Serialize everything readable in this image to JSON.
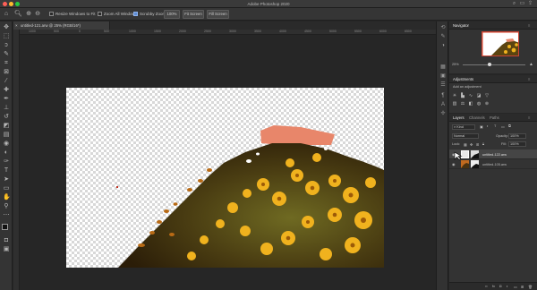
{
  "app": {
    "title": "Adobe Photoshop 2020"
  },
  "options_bar": {
    "resize_windows_label": "Resize Windows to Fit",
    "zoom_all_windows_label": "Zoom All Windows",
    "scrubby_zoom_label": "Scrubby Zoom",
    "btn_100": "100%",
    "btn_fit_screen": "Fit Screen",
    "btn_fill_screen": "Fill Screen"
  },
  "document_tab": {
    "label": "untitled-121.arw @ 25% (RGB/16*)"
  },
  "rulers": {
    "ticks": [
      "1000",
      "500",
      "0",
      "500",
      "1000",
      "1500",
      "2000",
      "2500",
      "3000",
      "3500",
      "4000",
      "4500",
      "5000",
      "5500",
      "6000",
      "6500"
    ]
  },
  "navigator": {
    "tab": "Navigator",
    "zoom": "25%"
  },
  "adjustments": {
    "tab": "Adjustments",
    "hint": "Add an adjustment"
  },
  "layers_panel": {
    "tabs": [
      "Layers",
      "Channels",
      "Paths"
    ],
    "kind_label": "Kind",
    "blend_mode": "Normal",
    "opacity_label": "Opacity:",
    "opacity_value": "100%",
    "lock_label": "Lock:",
    "fill_label": "Fill:",
    "fill_value": "100%",
    "layers": [
      {
        "name": "untitled-122.arw"
      },
      {
        "name": "untitled-105.arw"
      }
    ]
  },
  "colors": {
    "accent": "#c84d2d",
    "canvas_bg": "#262626"
  }
}
